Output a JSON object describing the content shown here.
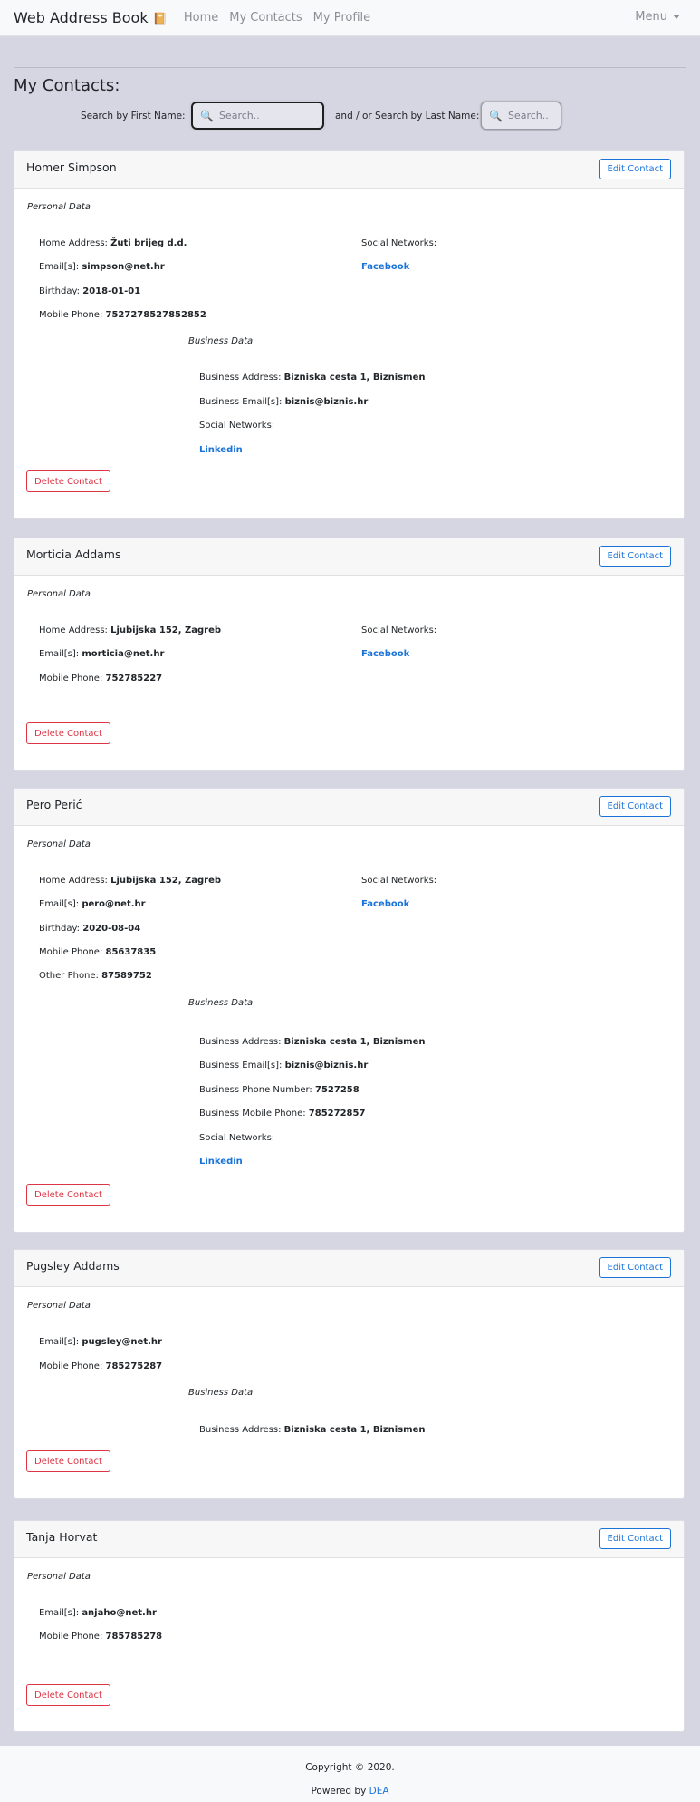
{
  "nav": {
    "brand": "Web Address Book",
    "brand_icon": "📔",
    "links": [
      "Home",
      "My Contacts",
      "My Profile"
    ],
    "menu": "Menu"
  },
  "page": {
    "title": "My Contacts:",
    "search_first_label": "Search by First Name:",
    "search_first_placeholder": "Search..",
    "search_last_label": "and / or Search by Last Name:",
    "search_last_placeholder": "Search.."
  },
  "labels": {
    "edit": "Edit Contact",
    "delete": "Delete Contact",
    "personal": "Personal Data",
    "business": "Business Data",
    "home_address": "Home Address: ",
    "emails": "Email[s]: ",
    "birthday": "Birthday: ",
    "mobile": "Mobile Phone: ",
    "other_phone": "Other Phone: ",
    "social": "Social Networks:",
    "business_address": "Business Address: ",
    "business_emails": "Business Email[s]: ",
    "business_phone": "Business Phone Number: ",
    "business_mobile": "Business Mobile Phone: "
  },
  "contacts": [
    {
      "name": "Homer Simpson",
      "home_address": "Žuti brijeg d.d.",
      "email": "simpson@net.hr",
      "birthday": "2018-01-01",
      "mobile": "7527278527852852",
      "social": "Facebook",
      "business_address": "Bizniska cesta 1, Biznismen",
      "business_email": "biznis@biznis.hr",
      "business_social": "Linkedin"
    },
    {
      "name": "Morticia Addams",
      "home_address": "Ljubijska 152, Zagreb",
      "email": "morticia@net.hr",
      "mobile": "752785227",
      "social": "Facebook"
    },
    {
      "name": "Pero Perić",
      "home_address": "Ljubijska 152, Zagreb",
      "email": "pero@net.hr",
      "birthday": "2020-08-04",
      "mobile": "85637835",
      "other_phone": "87589752",
      "social": "Facebook",
      "business_address": "Bizniska cesta 1, Biznismen",
      "business_email": "biznis@biznis.hr",
      "business_phone": "7527258",
      "business_mobile": "785272857",
      "business_social": "Linkedin"
    },
    {
      "name": "Pugsley Addams",
      "email": "pugsley@net.hr",
      "mobile": "785275287",
      "business_address": "Bizniska cesta 1, Biznismen"
    },
    {
      "name": "Tanja Horvat",
      "email": "anjaho@net.hr",
      "mobile": "785785278"
    }
  ],
  "footer": {
    "copyright": "Copyright © 2020.",
    "powered_prefix": "Powered by ",
    "powered_link": "DEA"
  }
}
